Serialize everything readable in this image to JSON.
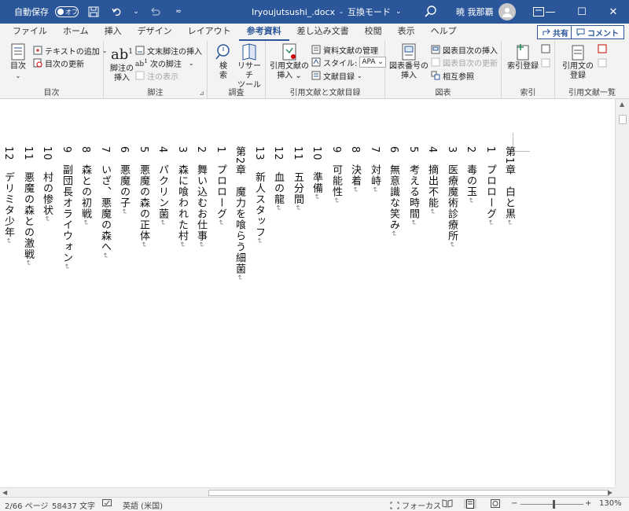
{
  "titlebar": {
    "autosave_label": "自動保存",
    "autosave_state": "オフ",
    "filename": "Iryoujutsushi_.docx",
    "separator": "-",
    "mode": "互換モード",
    "mode_caret": "⌄",
    "user_name": "暁 我那覇",
    "minimize": "—",
    "maximize": "☐",
    "close": "✕"
  },
  "tabs": [
    "ファイル",
    "ホーム",
    "挿入",
    "デザイン",
    "レイアウト",
    "参考資料",
    "差し込み文書",
    "校閲",
    "表示",
    "ヘルプ"
  ],
  "active_tab_index": 5,
  "share_label": "共有",
  "comment_label": "コメント",
  "ribbon": {
    "toc": {
      "label": "目次",
      "toc_button_l1": "目次",
      "toc_button_l2": "⌄",
      "add_text": "テキストの追加",
      "add_text_caret": "⌄",
      "update_toc": "目次の更新"
    },
    "footnotes": {
      "label": "脚注",
      "insert_footnote_l1": "脚注の",
      "insert_footnote_l2": "挿入",
      "insert_endnote": "文末脚注の挿入",
      "next_footnote": "次の脚注",
      "next_footnote_caret": "⌄",
      "show_notes": "注の表示",
      "launcher": "⊿"
    },
    "research": {
      "label": "調査",
      "search_l1": "検",
      "search_l2": "索",
      "researcher_l1": "リサーチ",
      "researcher_l2": "ツール"
    },
    "citations": {
      "label": "引用文献と文献目録",
      "insert_citation_l1": "引用文献の",
      "insert_citation_l2": "挿入 ⌄",
      "manage_sources": "資料文献の管理",
      "style_label": "スタイル:",
      "style_value": "APA",
      "bibliography": "文献目録",
      "bibliography_caret": "⌄"
    },
    "captions": {
      "label": "図表",
      "insert_caption_l1": "図表番号の",
      "insert_caption_l2": "挿入",
      "insert_table_of_figures": "図表目次の挿入",
      "update_table": "図表目次の更新",
      "cross_reference": "相互参照"
    },
    "index": {
      "label": "索引",
      "mark_entry": "索引登録"
    },
    "toa": {
      "label": "引用文献一覧",
      "mark_citation_l1": "引用文の",
      "mark_citation_l2": "登録"
    }
  },
  "document": {
    "columns": [
      "第1章　白と黒",
      "1　プロローグ",
      "2　毒の玉",
      "3　医療魔術診療所",
      "4　摘出不能",
      "5　考える時間",
      "6　無意識な笑み",
      "7　対峙",
      "8　決着",
      "9　可能性",
      "10　準備",
      "11　五分間",
      "12　血の龍",
      "13　新人スタッフ",
      "第2章　魔力を喰らう細菌",
      "1　プロローグ",
      "2　舞い込むお仕事",
      "3　森に喰われた村",
      "4　パクリン菌",
      "5　悪魔の森の正体",
      "6　悪魔の子",
      "7　いざ、悪魔の森へ",
      "8　森との初戦",
      "9　副団長オライウォン",
      "10　村の惨状",
      "11　悪魔の森との激戦",
      "12　デリミタ少年"
    ],
    "para_mark": "↵"
  },
  "statusbar": {
    "page": "2/66 ページ",
    "word_count": "58437 文字",
    "language": "英語 (米国)",
    "focus": "フォーカス",
    "zoom_minus": "−",
    "zoom_plus": "+",
    "zoom_level": "130%"
  }
}
